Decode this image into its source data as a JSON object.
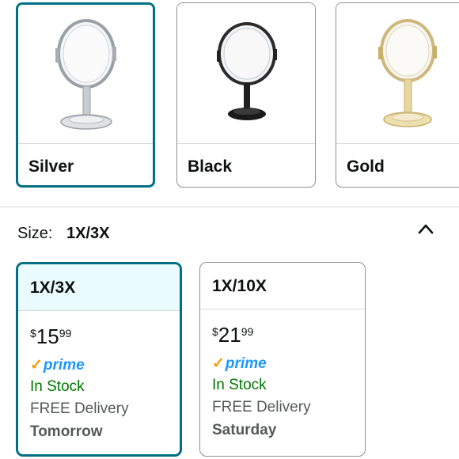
{
  "swatches": [
    {
      "label": "Silver",
      "selected": true
    },
    {
      "label": "Black",
      "selected": false
    },
    {
      "label": "Gold",
      "selected": false
    }
  ],
  "size": {
    "key_label": "Size:",
    "selected_value": "1X/3X"
  },
  "options": [
    {
      "title": "1X/3X",
      "currency": "$",
      "price_whole": "15",
      "price_cents": "99",
      "prime": "prime",
      "stock": "In Stock",
      "delivery": "FREE Delivery",
      "when": "Tomorrow",
      "selected": true
    },
    {
      "title": "1X/10X",
      "currency": "$",
      "price_whole": "21",
      "price_cents": "99",
      "prime": "prime",
      "stock": "In Stock",
      "delivery": "FREE Delivery",
      "when": "Saturday",
      "selected": false
    }
  ],
  "colors": {
    "accent": "#007185",
    "selected_bg": "#e9fbfe",
    "prime": "#1a98ff",
    "stock": "#007600"
  },
  "icons": {
    "collapse": "chevron-up-icon",
    "prime_check": "prime-check-icon"
  }
}
